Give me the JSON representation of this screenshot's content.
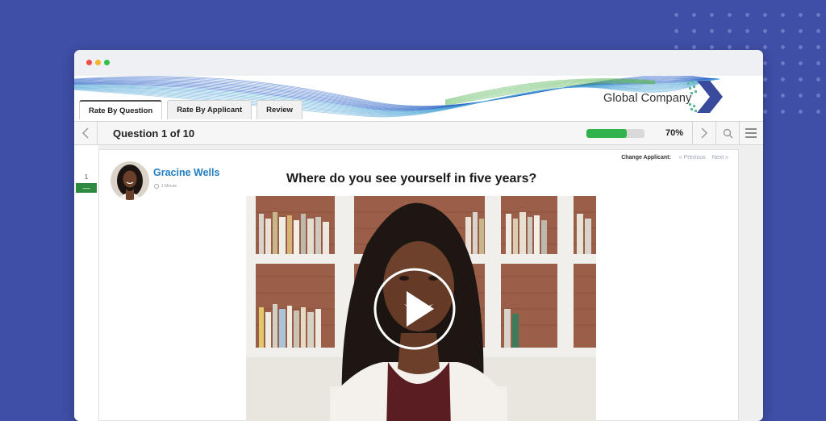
{
  "banner": {
    "company_name": "Global Company"
  },
  "tabs": [
    {
      "label": "Rate By Question",
      "active": true
    },
    {
      "label": "Rate By Applicant",
      "active": false
    },
    {
      "label": "Review",
      "active": false
    }
  ],
  "toolbar": {
    "question_label": "Question 1 of 10",
    "progress_percent_text": "70%",
    "progress_fraction": 0.7,
    "prev_icon": "chevron-left-icon",
    "next_icon": "chevron-right-icon",
    "search_icon": "search-icon",
    "menu_icon": "hamburger-menu-icon"
  },
  "sidebar": {
    "question_number": "1",
    "status_text": "—"
  },
  "applicant": {
    "change_label": "Change Applicant:",
    "previous": "« Previous",
    "next": "Next »",
    "name": "Gracine Wells",
    "duration": "1 Minute"
  },
  "question_text": "Where do you see yourself in five years?",
  "colors": {
    "page_background": "#3f4ea6",
    "progress_fill": "#2fb34a",
    "name_link": "#1f7dc2",
    "status_bar": "#2e8a3e"
  }
}
